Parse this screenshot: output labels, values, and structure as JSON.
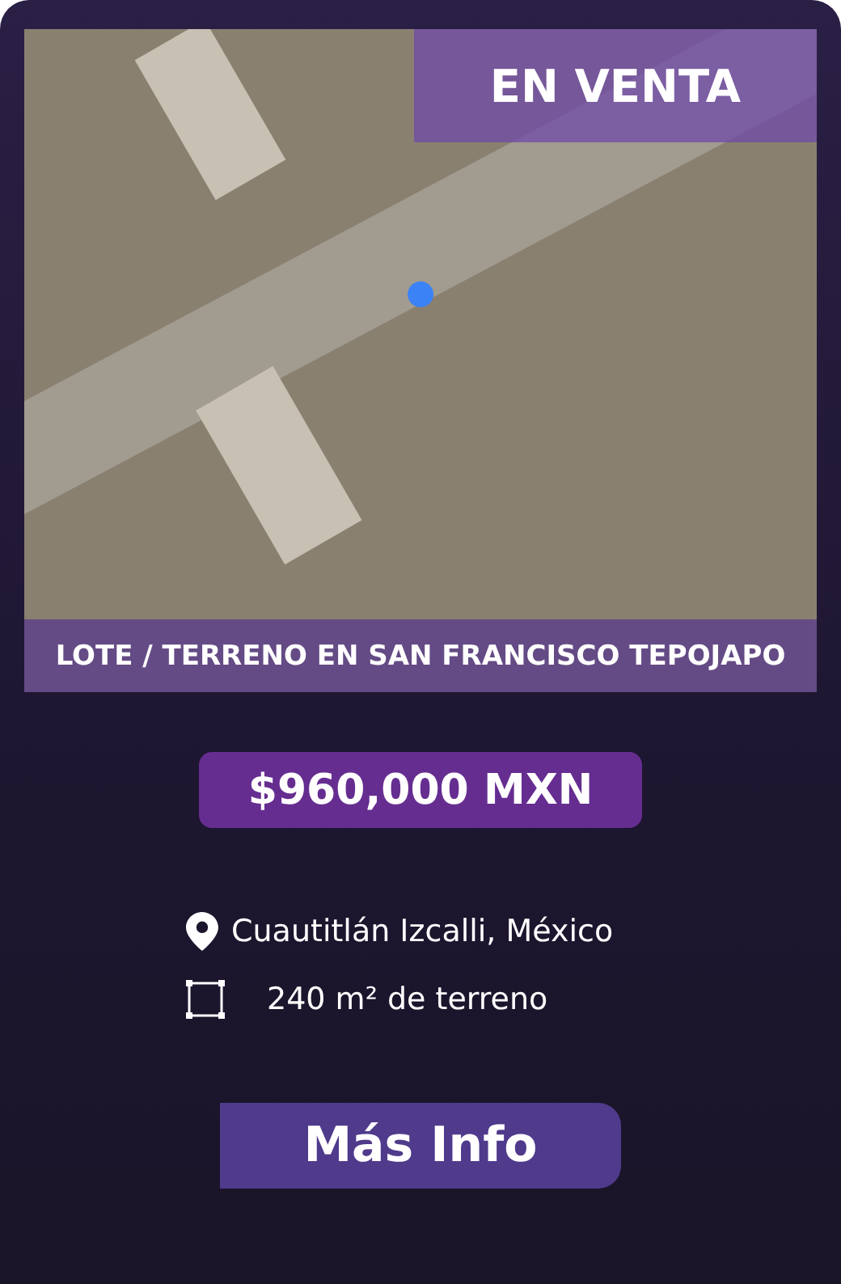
{
  "listing": {
    "badge": "EN VENTA",
    "title": "LOTE / TERRENO EN SAN FRANCISCO TEPOJAPO",
    "price": "$960,000 MXN",
    "location": "Cuautitlán Izcalli, México",
    "area": "240 m² de terreno",
    "button": "Más Info"
  }
}
